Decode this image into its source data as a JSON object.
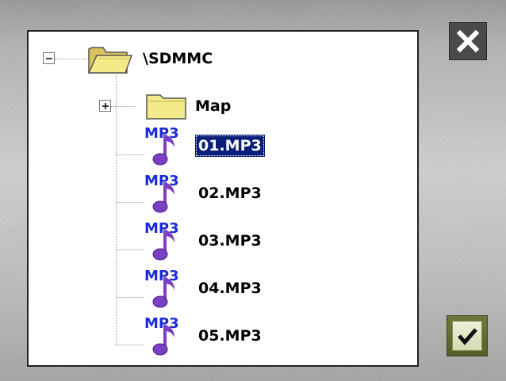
{
  "dialog": {
    "close_icon": "close-icon",
    "ok_icon": "check-icon"
  },
  "tree": {
    "root": {
      "label": "\\SDMMC",
      "expanded": true,
      "icon": "open-folder-icon"
    },
    "children": [
      {
        "label": "Map",
        "type": "folder",
        "expanded": false,
        "icon": "folder-icon"
      },
      {
        "label": "01.MP3",
        "type": "file",
        "icon_text": "MP3",
        "icon": "mp3-file-icon",
        "selected": true
      },
      {
        "label": "02.MP3",
        "type": "file",
        "icon_text": "MP3",
        "icon": "mp3-file-icon",
        "selected": false
      },
      {
        "label": "03.MP3",
        "type": "file",
        "icon_text": "MP3",
        "icon": "mp3-file-icon",
        "selected": false
      },
      {
        "label": "04.MP3",
        "type": "file",
        "icon_text": "MP3",
        "icon": "mp3-file-icon",
        "selected": false
      },
      {
        "label": "05.MP3",
        "type": "file",
        "icon_text": "MP3",
        "icon": "mp3-file-icon",
        "selected": false
      }
    ]
  },
  "colors": {
    "selection_bg": "#0a1f78",
    "mp3_text": "#1a2bd6",
    "note": "#7b3fc4",
    "folder": "#f3ea8a"
  }
}
